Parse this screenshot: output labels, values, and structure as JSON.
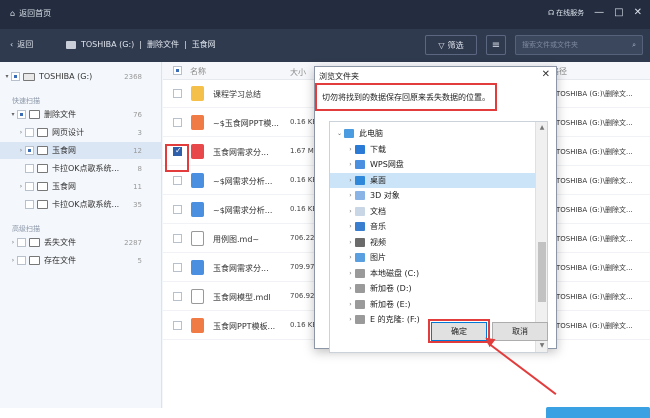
{
  "titlebar": {
    "home_label": "返回首页",
    "service_label": "在线服务",
    "controls": [
      "—",
      "□",
      "✕"
    ]
  },
  "navbar": {
    "back_label": "返回",
    "crumbs": [
      "TOSHIBA (G:)",
      "删除文件",
      "玉食网"
    ],
    "filter_label": "筛选",
    "search_placeholder": "搜索文件或文件夹"
  },
  "sidebar": {
    "drive": {
      "label": "TOSHIBA (G:)",
      "count": "2368"
    },
    "quick_scan_label": "快速扫描",
    "quick_items": [
      {
        "label": "删除文件",
        "count": "76"
      },
      {
        "label": "网页设计",
        "count": "3"
      },
      {
        "label": "玉食网",
        "count": "12"
      },
      {
        "label": "卡拉OK点歌系统...",
        "count": "8"
      },
      {
        "label": "玉食网",
        "count": "11"
      },
      {
        "label": "卡拉OK点歌系统...",
        "count": "35"
      }
    ],
    "advanced_scan_label": "高级扫描",
    "advanced_items": [
      {
        "label": "丢失文件",
        "count": "2287"
      },
      {
        "label": "存在文件",
        "count": "5"
      }
    ]
  },
  "list": {
    "headers": {
      "name": "名称",
      "size": "大小",
      "path": "路径"
    },
    "rows": [
      {
        "name": "课程学习总结",
        "size": "",
        "path": "TOSHIBA (G:)\\删除文...",
        "type": "folder"
      },
      {
        "name": "~$玉食网PPT模...",
        "size": "0.16 KB",
        "path": "TOSHIBA (G:)\\删除文...",
        "type": "ppt"
      },
      {
        "name": "玉食网需求分...",
        "size": "1.67 MB",
        "path": "TOSHIBA (G:)\\删除文...",
        "type": "pdf"
      },
      {
        "name": "~$网需求分析...",
        "size": "0.16 KB",
        "path": "TOSHIBA (G:)\\删除文...",
        "type": "word"
      },
      {
        "name": "~$网需求分析...",
        "size": "0.16 KB",
        "path": "TOSHIBA (G:)\\删除文...",
        "type": "word"
      },
      {
        "name": "用例图.md~",
        "size": "706.22",
        "path": "TOSHIBA (G:)\\删除文...",
        "type": "doc"
      },
      {
        "name": "玉食网需求分...",
        "size": "709.97",
        "path": "TOSHIBA (G:)\\删除文...",
        "type": "word"
      },
      {
        "name": "玉食网模型.mdl",
        "size": "706.92",
        "path": "TOSHIBA (G:)\\删除文...",
        "type": "doc"
      },
      {
        "name": "玉食网PPT模板...",
        "size": "0.16 KB",
        "path": "TOSHIBA (G:)\\删除文...",
        "type": "ppt"
      }
    ]
  },
  "dialog": {
    "title": "浏览文件夹",
    "close": "✕",
    "message": "切勿将找到的数据保存回原来丢失数据的位置。",
    "tree": [
      {
        "label": "此电脑",
        "indent": 0,
        "icon": "computer-icon",
        "twisty": "⌄"
      },
      {
        "label": "下载",
        "indent": 1,
        "icon": "download-icon",
        "twisty": "›"
      },
      {
        "label": "WPS网盘",
        "indent": 1,
        "icon": "cloud-icon",
        "twisty": "›"
      },
      {
        "label": "桌面",
        "indent": 1,
        "icon": "desktop-icon",
        "twisty": "›",
        "selected": true
      },
      {
        "label": "3D 对象",
        "indent": 1,
        "icon": "cube-icon",
        "twisty": "›"
      },
      {
        "label": "文档",
        "indent": 1,
        "icon": "document-icon",
        "twisty": "›"
      },
      {
        "label": "音乐",
        "indent": 1,
        "icon": "music-icon",
        "twisty": "›"
      },
      {
        "label": "视频",
        "indent": 1,
        "icon": "video-icon",
        "twisty": "›"
      },
      {
        "label": "图片",
        "indent": 1,
        "icon": "picture-icon",
        "twisty": "›"
      },
      {
        "label": "本地磁盘 (C:)",
        "indent": 1,
        "icon": "drive-icon",
        "twisty": "›"
      },
      {
        "label": "新加卷 (D:)",
        "indent": 1,
        "icon": "drive-icon",
        "twisty": "›"
      },
      {
        "label": "新加卷 (E:)",
        "indent": 1,
        "icon": "drive-icon",
        "twisty": "›"
      },
      {
        "label": "E 的克隆:  (F:)",
        "indent": 1,
        "icon": "drive-icon",
        "twisty": "›"
      }
    ],
    "ok_label": "确定",
    "cancel_label": "取消"
  },
  "colors": {
    "titlebar": "#232d3f",
    "navbar": "#2f3a4e",
    "annotation_red": "#e23c3c",
    "selection_blue": "#cce4f7"
  }
}
